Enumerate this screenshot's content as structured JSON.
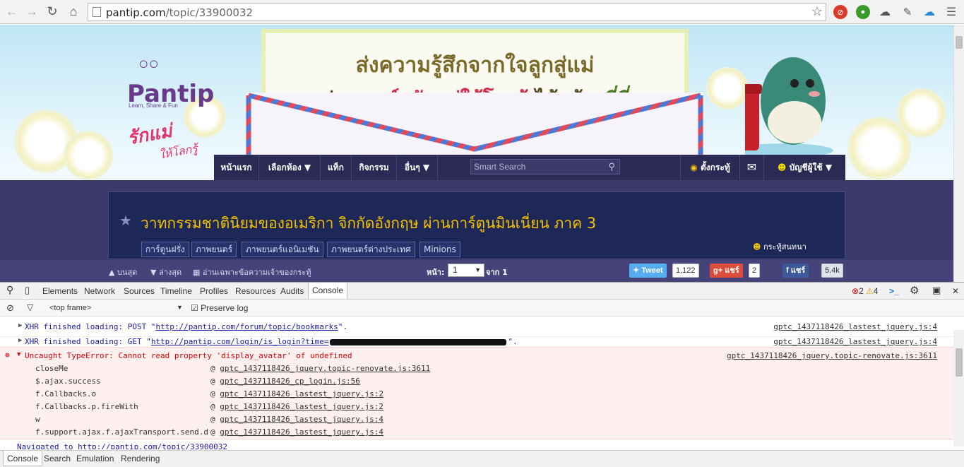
{
  "browser": {
    "url_host": "pantip.com",
    "url_path": "/topic/33900032"
  },
  "banner": {
    "logo_text": "Pantip",
    "logo_tagline": "Learn, Share & Fun",
    "campaign": "รักแม่",
    "campaign_sub": "ให้โลกรู้",
    "headline_1": "ส่งความรู้สึกจากใจลูกสู่แม่",
    "headline_2_pre": "ผ่าน",
    "headline_2_hot": "การ์ดรักแม่ให้โลกรู้",
    "headline_2_mid": "ได้แล้ว",
    "headline_2_end": "ที่นี่"
  },
  "nav": {
    "home": "หน้าแรก",
    "rooms": "เลือกห้อง ▼",
    "tags": "แท็ก",
    "activity": "กิจกรรม",
    "more": "อื่นๆ ▼",
    "search_placeholder": "Smart Search",
    "post": "ตั้งกระทู้",
    "account": "บัญชีผู้ใช้ ▼"
  },
  "topic": {
    "title": "วาทกรรมชาตินิยมของอเมริกา จิกกัดอังกฤษ ผ่านการ์ตูนมินเนี่ยน ภาค 3",
    "tags": [
      "การ์ตูนฝรั่ง",
      "ภาพยนตร์",
      "ภาพยนตร์แอนิเมชัน",
      "ภาพยนตร์ต่างประเทศ",
      "Minions"
    ],
    "chat_label": "กระทู้สนทนา"
  },
  "pagebar": {
    "top": "บนสุด",
    "bottom": "ล่างสุด",
    "owner_only": "อ่านเฉพาะข้อความเจ้าของกระทู้",
    "page_label": "หน้า:",
    "page_value": "1",
    "of_label": "จาก 1",
    "tweet": "Tweet",
    "tweet_count": "1,122",
    "gplus": "แชร์",
    "gplus_count": "2",
    "fb": "แชร์",
    "fb_count": "5.4k"
  },
  "devtools": {
    "tabs": [
      "Elements",
      "Network",
      "Sources",
      "Timeline",
      "Profiles",
      "Resources",
      "Audits",
      "Console"
    ],
    "errors": "2",
    "warnings": "4",
    "frame": "<top frame>",
    "preserve_log": "Preserve log",
    "log": [
      {
        "prefix": "XHR finished loading: POST \"",
        "url": "http://pantip.com/forum/topic/bookmarks",
        "suffix": "\".",
        "source": "gptc_1437118426_lastest_jquery.js:4"
      },
      {
        "prefix": "XHR finished loading: GET \"",
        "url": "http://pantip.com/login/is_login?time=",
        "suffix": "\".",
        "source": "gptc_1437118426_lastest_jquery.js:4"
      }
    ],
    "error": {
      "message": "Uncaught TypeError: Cannot read property 'display_avatar' of undefined",
      "source": "gptc_1437118426_jquery.topic-renovate.js:3611",
      "stack": [
        {
          "fn": "closeMe",
          "loc": "gptc_1437118426_jquery.topic-renovate.js:3611"
        },
        {
          "fn": "$.ajax.success",
          "loc": "gptc_1437118426_cp_login.js:56"
        },
        {
          "fn": "f.Callbacks.o",
          "loc": "gptc_1437118426_lastest_jquery.js:2"
        },
        {
          "fn": "f.Callbacks.p.fireWith",
          "loc": "gptc_1437118426_lastest_jquery.js:2"
        },
        {
          "fn": "w",
          "loc": "gptc_1437118426_lastest_jquery.js:4"
        },
        {
          "fn": "f.support.ajax.f.ajaxTransport.send.d",
          "loc": "gptc_1437118426_lastest_jquery.js:4"
        }
      ]
    },
    "navigated": "Navigated to http://pantip.com/topic/33900032",
    "drawer_tabs": [
      "Console",
      "Search",
      "Emulation",
      "Rendering"
    ]
  }
}
